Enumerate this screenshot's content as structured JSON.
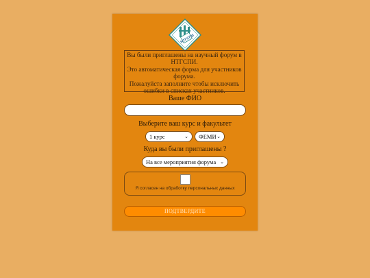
{
  "info": {
    "line1": "Вы были приглашены на научный форум в НТГСПИ.",
    "line2": "Это автоматическая форма для участников форума.",
    "line3": "Пожалуйста заполните чтобы исключить ошибки в списках участников."
  },
  "logo": {
    "icon": "ntgspi-logo-icon",
    "text": "НТГСПИ"
  },
  "fio": {
    "label": "Ваше ФИО",
    "value": "",
    "placeholder": ""
  },
  "course_faculty": {
    "label": "Выберите ваш курс и факультет",
    "course_selected": "1 курс",
    "faculty_selected": "ФЕМИ"
  },
  "invitation": {
    "label": "Куда вы были приглашены ?",
    "selected": "На все мероприятия форума"
  },
  "consent": {
    "label": "Я согласен на обработку персональных данных",
    "checked": false
  },
  "submit": {
    "label": "ПОДТВЕРДИТЕ"
  },
  "colors": {
    "background": "#e9ae62",
    "card": "#e3860f",
    "button": "#ff8c00"
  }
}
